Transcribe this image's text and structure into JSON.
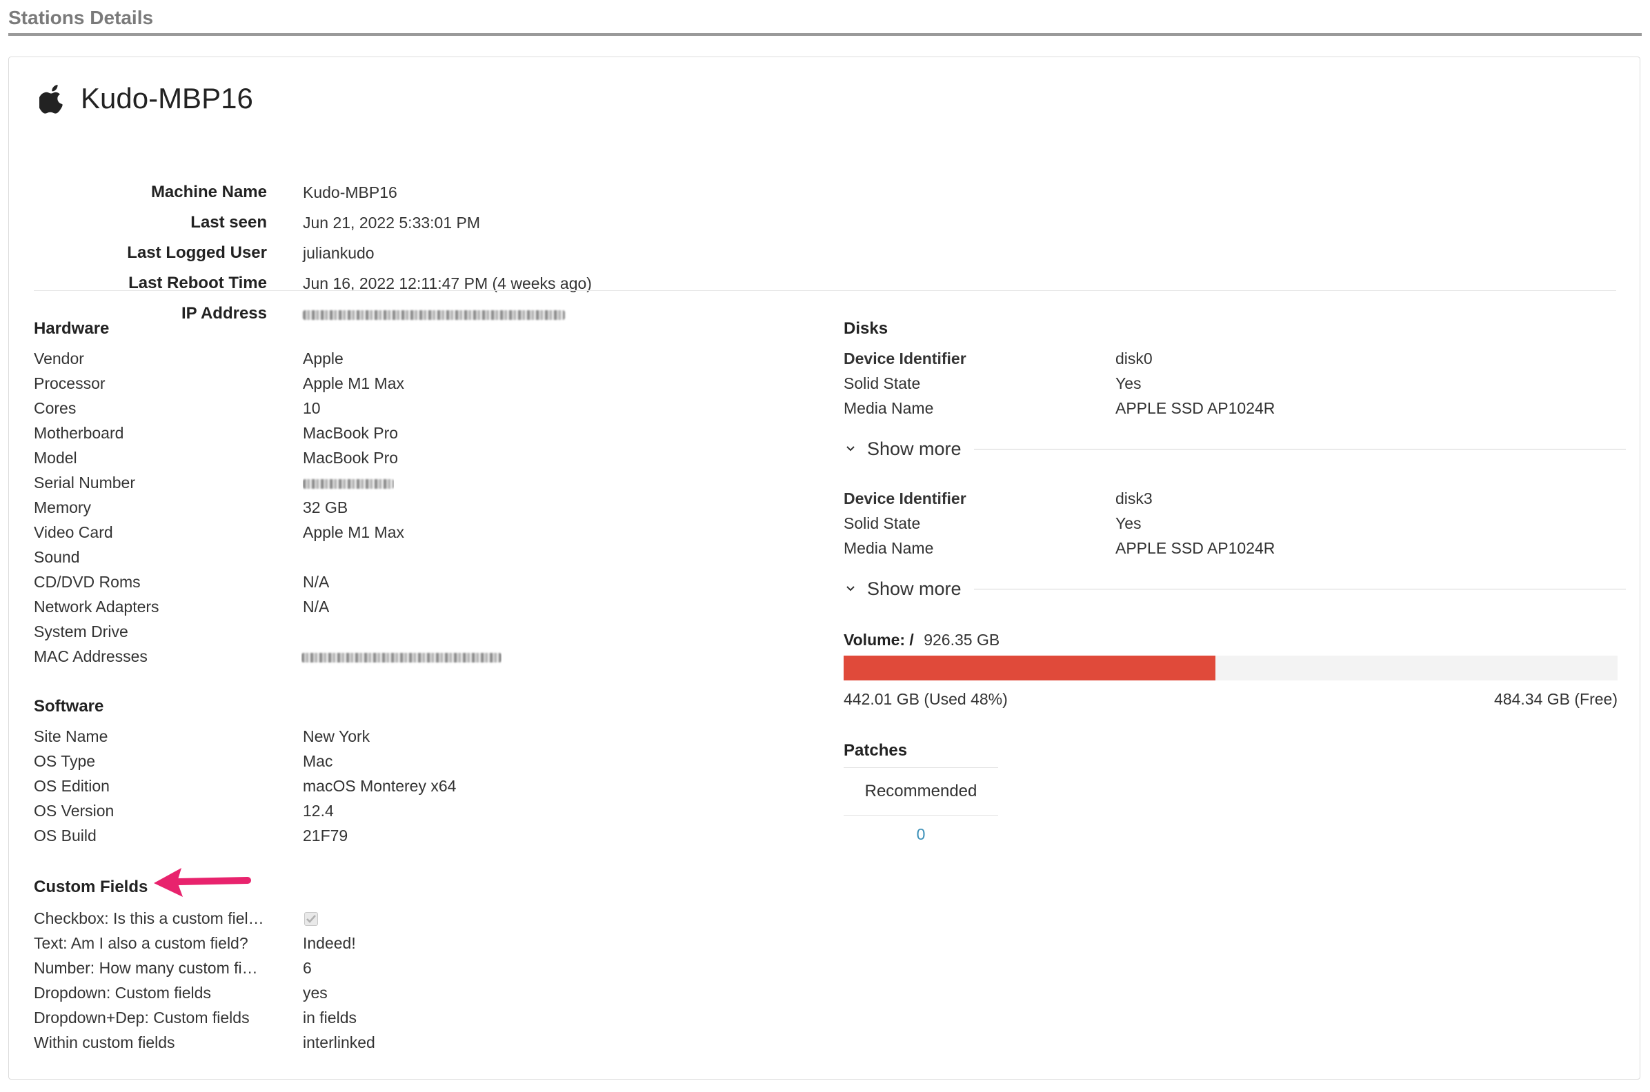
{
  "page": {
    "title": "Stations Details"
  },
  "machine": {
    "icon": "apple-logo-icon",
    "name": "Kudo-MBP16",
    "summary": [
      {
        "label": "Machine Name",
        "value": "Kudo-MBP16"
      },
      {
        "label": "Last seen",
        "value": "Jun 21, 2022 5:33:01 PM"
      },
      {
        "label": "Last Logged User",
        "value": "juliankudo"
      },
      {
        "label": "Last Reboot Time",
        "value": "Jun 16, 2022 12:11:47 PM (4 weeks ago)"
      },
      {
        "label": "IP Address",
        "value": ""
      }
    ]
  },
  "hardware": {
    "title": "Hardware",
    "rows": [
      {
        "label": "Vendor",
        "value": "Apple"
      },
      {
        "label": "Processor",
        "value": "Apple M1 Max"
      },
      {
        "label": "Cores",
        "value": "10"
      },
      {
        "label": "Motherboard",
        "value": "MacBook Pro"
      },
      {
        "label": "Model",
        "value": "MacBook Pro"
      },
      {
        "label": "Serial Number",
        "value": ""
      },
      {
        "label": "Memory",
        "value": "32 GB"
      },
      {
        "label": "Video Card",
        "value": "Apple M1 Max"
      },
      {
        "label": "Sound",
        "value": ""
      },
      {
        "label": "CD/DVD Roms",
        "value": "N/A"
      },
      {
        "label": "Network Adapters",
        "value": "N/A"
      },
      {
        "label": "System Drive",
        "value": ""
      },
      {
        "label": "MAC Addresses",
        "value": ""
      }
    ]
  },
  "software": {
    "title": "Software",
    "rows": [
      {
        "label": "Site Name",
        "value": "New York"
      },
      {
        "label": "OS Type",
        "value": "Mac"
      },
      {
        "label": "OS Edition",
        "value": "macOS Monterey x64"
      },
      {
        "label": "OS Version",
        "value": "12.4"
      },
      {
        "label": "OS Build",
        "value": "21F79"
      }
    ]
  },
  "custom_fields": {
    "title": "Custom Fields",
    "rows": [
      {
        "label": "Checkbox: Is this a custom fiel…",
        "value": ""
      },
      {
        "label": "Text: Am I also a custom field?",
        "value": "Indeed!"
      },
      {
        "label": "Number: How many custom fi…",
        "value": "6"
      },
      {
        "label": "Dropdown: Custom fields",
        "value": "yes"
      },
      {
        "label": "Dropdown+Dep: Custom fields",
        "value": "in fields"
      },
      {
        "label": "Within custom fields",
        "value": "interlinked"
      }
    ],
    "checkbox_checked": true
  },
  "disks": {
    "title": "Disks",
    "items": [
      {
        "rows": [
          {
            "label": "Device Identifier",
            "value": "disk0"
          },
          {
            "label": "Solid State",
            "value": "Yes"
          },
          {
            "label": "Media Name",
            "value": "APPLE SSD AP1024R"
          }
        ],
        "show_more": "Show more"
      },
      {
        "rows": [
          {
            "label": "Device Identifier",
            "value": "disk3"
          },
          {
            "label": "Solid State",
            "value": "Yes"
          },
          {
            "label": "Media Name",
            "value": "APPLE SSD AP1024R"
          }
        ],
        "show_more": "Show more"
      }
    ],
    "volume": {
      "label": "Volume: /",
      "size": "926.35 GB",
      "used_text": "442.01 GB (Used 48%)",
      "free_text": "484.34 GB (Free)",
      "used_fraction": 0.48,
      "bar_color": "#e04a3a"
    }
  },
  "patches": {
    "title": "Patches",
    "column": "Recommended",
    "value": "0"
  },
  "colors": {
    "accent_link": "#3a8fb7",
    "annotation_arrow": "#e8236d"
  }
}
